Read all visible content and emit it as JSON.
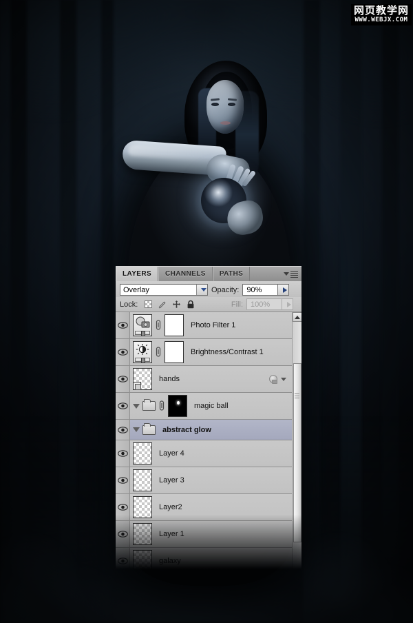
{
  "watermark": {
    "cn": "网页教学网",
    "url": "WWW.WEBJX.COM"
  },
  "panel": {
    "tabs": [
      {
        "label": "LAYERS",
        "active": true
      },
      {
        "label": "CHANNELS",
        "active": false
      },
      {
        "label": "PATHS",
        "active": false
      }
    ],
    "menu_icon": "panel-menu-icon",
    "blend_mode": {
      "value": "Overlay",
      "dropdown_icon": "chevron-down-icon"
    },
    "opacity": {
      "label": "Opacity:",
      "value": "90%",
      "stepper_icon": "chevron-right-icon"
    },
    "lock": {
      "label": "Lock:",
      "icons": [
        "transparent-pixels-icon",
        "paintbrush-icon",
        "move-icon",
        "lock-all-icon"
      ]
    },
    "fill": {
      "label": "Fill:",
      "value": "100%",
      "disabled": true,
      "stepper_icon": "chevron-right-icon"
    },
    "scrollbar": {
      "up_arrow_icon": "chevron-up-icon"
    },
    "layers": [
      {
        "name": "Photo Filter 1",
        "visible": true,
        "kind": "adjustment",
        "thumb": "photo-filter-icon",
        "linked": true,
        "mask": "white",
        "indent": 0,
        "selected": false
      },
      {
        "name": "Brightness/Contrast 1",
        "visible": true,
        "kind": "adjustment",
        "thumb": "brightness-contrast-icon",
        "linked": true,
        "mask": "white",
        "indent": 0,
        "selected": false
      },
      {
        "name": "hands",
        "visible": true,
        "kind": "smart-object",
        "thumb": "checker",
        "linked": false,
        "indent": 0,
        "selected": false,
        "effects": true
      },
      {
        "name": "magic ball",
        "visible": true,
        "kind": "group",
        "thumb": "mask-black",
        "linked": true,
        "expanded": true,
        "indent": 0,
        "selected": false
      },
      {
        "name": "abstract glow",
        "visible": true,
        "kind": "group",
        "expanded": true,
        "indent": 1,
        "selected": true
      },
      {
        "name": "Layer 4",
        "visible": true,
        "kind": "pixel",
        "thumb": "checker",
        "indent": 2,
        "selected": false
      },
      {
        "name": "Layer 3",
        "visible": true,
        "kind": "pixel",
        "thumb": "checker",
        "indent": 2,
        "selected": false
      },
      {
        "name": "Layer2",
        "visible": true,
        "kind": "pixel",
        "thumb": "checker",
        "indent": 2,
        "selected": false
      },
      {
        "name": "Layer 1",
        "visible": true,
        "kind": "pixel",
        "thumb": "checker",
        "indent": 2,
        "selected": false
      },
      {
        "name": "galaxy",
        "visible": true,
        "kind": "pixel",
        "thumb": "checker",
        "indent": 1,
        "selected": false
      }
    ]
  },
  "colors": {
    "panel_bg": "#c6c6c6",
    "tab_active": "#d2d2d2",
    "row_selected": "#a8acc0",
    "accent_blue": "#2f4f8f",
    "border": "#8f8f8f"
  }
}
